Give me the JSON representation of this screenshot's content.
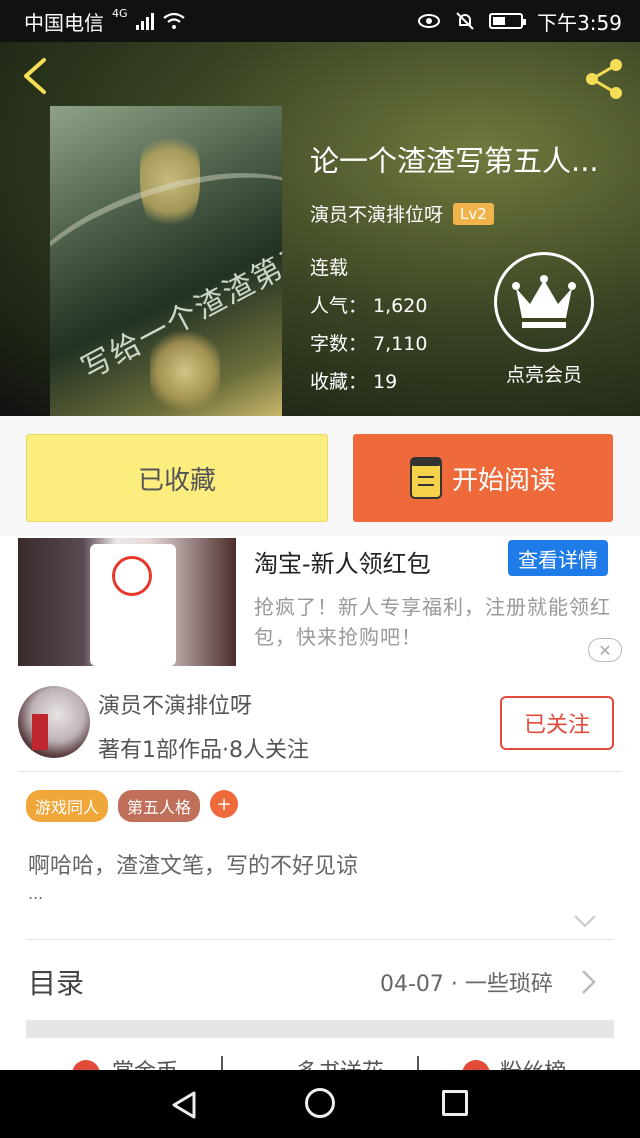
{
  "status_bar": {
    "carrier": "中国电信",
    "network": "4G",
    "time": "下午3:59"
  },
  "book": {
    "title": "论一个渣渣写第五人...",
    "author": "演员不演排位呀",
    "level": "Lv2",
    "status": "连载",
    "popularity_label": "人气：",
    "popularity": "1,620",
    "words_label": "字数：",
    "words": "7,110",
    "favorites_label": "收藏：",
    "favorites": "19",
    "cover_text": "写给一个渣渣第五人同人文"
  },
  "vip": {
    "label": "点亮会员"
  },
  "actions": {
    "favorited_label": "已收藏",
    "read_label": "开始阅读"
  },
  "ad": {
    "title": "淘宝-新人领红包",
    "detail_label": "查看详情",
    "description": "抢疯了！新人专享福利，注册就能领红包，快来抢购吧！"
  },
  "author_section": {
    "name": "演员不演排位呀",
    "stats": "著有1部作品·8人关注",
    "follow_label": "已关注",
    "tags": [
      "游戏同人",
      "第五人格"
    ],
    "add_tag_label": "+",
    "description": "啊哈哈，渣渣文笔，写的不好见谅",
    "ellipsis": "...",
    "toc_label": "目录",
    "toc_latest": "04-07 · 一些琐碎"
  },
  "bottom_tabs": [
    "赏金币",
    "多书送花",
    "粉丝榜"
  ],
  "colors": {
    "favorite_button": "#fbee7f",
    "read_button": "#ef6a3a",
    "detail_button": "#1f7be8",
    "level_badge": "#f0b44a"
  }
}
